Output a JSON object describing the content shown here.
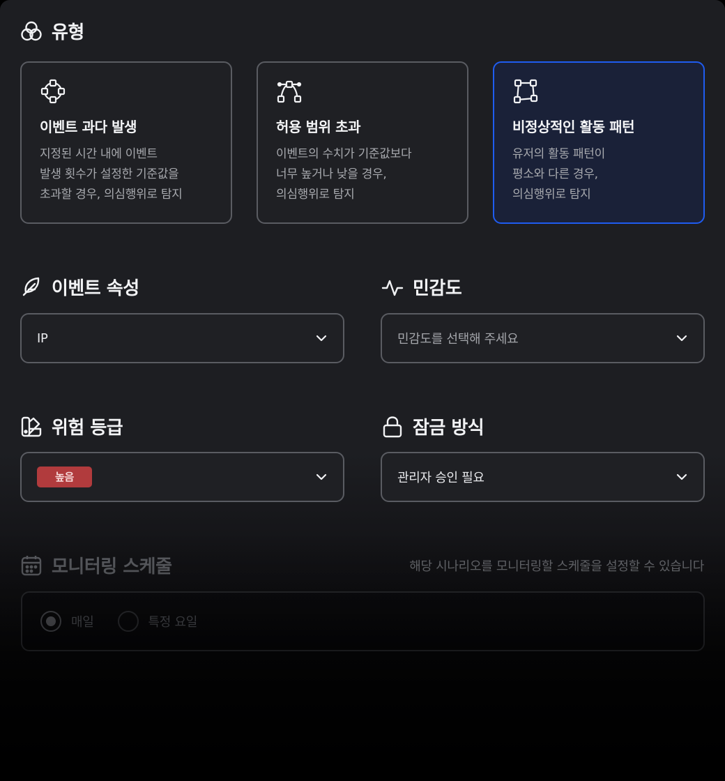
{
  "type_section": {
    "title": "유형"
  },
  "cards": [
    {
      "title": "이벤트 과다 발생",
      "desc": [
        "지정된 시간 내에 이벤트",
        "발생 횟수가 설정한 기준값을",
        "초과할 경우, 의심행위로 탐지"
      ],
      "icon": "circle-nodes-icon",
      "selected": false
    },
    {
      "title": "허용 범위 초과",
      "desc": [
        "이벤트의 수치가 기준값보다",
        "너무 높거나 낮을 경우,",
        "의심행위로 탐지"
      ],
      "icon": "bezier-curve-icon",
      "selected": false
    },
    {
      "title": "비정상적인 활동 패턴",
      "desc": [
        "유저의 활동 패턴이",
        "평소와 다른 경우,",
        "의심행위로 탐지"
      ],
      "icon": "vector-shape-icon",
      "selected": true
    }
  ],
  "event_attribute": {
    "title": "이벤트 속성",
    "value": "IP",
    "icon": "feather-icon"
  },
  "sensitivity": {
    "title": "민감도",
    "placeholder": "민감도를 선택해 주세요",
    "icon": "pulse-icon"
  },
  "risk_level": {
    "title": "위험 등급",
    "value": "높음",
    "badge_color": "#b13b3d",
    "icon": "swatchbook-icon"
  },
  "lock_method": {
    "title": "잠금 방식",
    "value": "관리자 승인 필요",
    "icon": "lock-icon"
  },
  "schedule": {
    "title": "모니터링 스케줄",
    "subtitle": "해당 시나리오를 모니터링할 스케줄을 설정할 수 있습니다",
    "icon": "calendar-icon",
    "options": [
      {
        "label": "매일",
        "checked": true
      },
      {
        "label": "특정 요일",
        "checked": false
      }
    ]
  },
  "colors": {
    "accent": "#1f5cf0",
    "border": "#5a5c62",
    "background": "#1d1e22"
  }
}
